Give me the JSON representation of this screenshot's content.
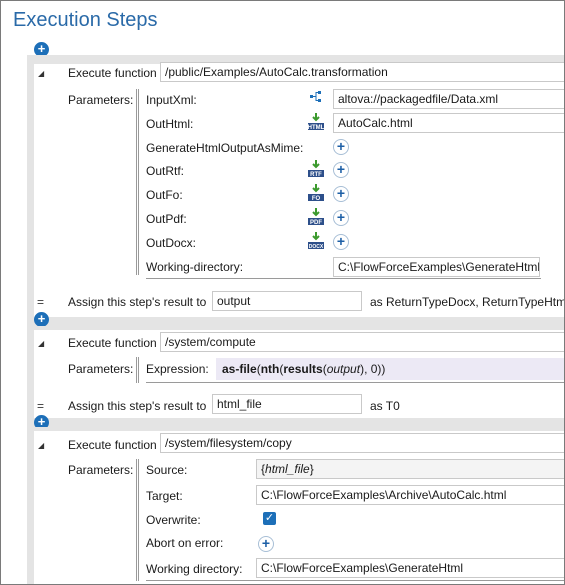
{
  "title": "Execution Steps",
  "step1": {
    "label": "Execute function",
    "function_path": "/public/Examples/AutoCalc.transformation",
    "params_label": "Parameters:",
    "params": [
      {
        "name": "InputXml:",
        "value": "altova://packagedfile/Data.xml",
        "icon": "xml-tree-icon"
      },
      {
        "name": "OutHtml:",
        "value": "AutoCalc.html",
        "icon": "html-output-icon"
      },
      {
        "name": "GenerateHtmlOutputAsMime:",
        "value": ""
      },
      {
        "name": "OutRtf:",
        "value": "",
        "icon": "rtf-output-icon"
      },
      {
        "name": "OutFo:",
        "value": "",
        "icon": "fo-output-icon"
      },
      {
        "name": "OutPdf:",
        "value": "",
        "icon": "pdf-output-icon"
      },
      {
        "name": "OutDocx:",
        "value": "",
        "icon": "docx-output-icon"
      },
      {
        "name": "Working-directory:",
        "value": "C:\\FlowForceExamples\\GenerateHtml"
      }
    ],
    "icon_texts": {
      "html": "HTML",
      "rtf": "RTF",
      "fo": "FO",
      "pdf": "PDF",
      "docx": "DOCX"
    },
    "assign_label": "Assign this step's result to",
    "assign_value": "output",
    "assign_type": "as ReturnTypeDocx, ReturnTypeHtml,"
  },
  "step2": {
    "label": "Execute function",
    "function_path": "/system/compute",
    "params_label": "Parameters:",
    "expr_name": "Expression:",
    "expr": {
      "fn1": "as-file",
      "p1": "(",
      "fn2": "nth",
      "p2": "(",
      "fn3": "results",
      "p3": "(",
      "arg": "output",
      "p4": "), 0))"
    },
    "assign_label": "Assign this step's result to",
    "assign_value": "html_file",
    "assign_type": "as T0"
  },
  "step3": {
    "label": "Execute function",
    "function_path": "/system/filesystem/copy",
    "params_label": "Parameters:",
    "source_label": "Source:",
    "source_open": "{",
    "source_var": "html_file",
    "source_close": "}",
    "target_label": "Target:",
    "target_value": "C:\\FlowForceExamples\\Archive\\AutoCalc.html",
    "overwrite_label": "Overwrite:",
    "overwrite_checked": true,
    "abort_label": "Abort on error:",
    "workdir_label": "Working directory:",
    "workdir_value": "C:\\FlowForceExamples\\GenerateHtml"
  },
  "symbols": {
    "plus": "+",
    "eq": "=",
    "collapse": "◢",
    "check": "✓"
  }
}
